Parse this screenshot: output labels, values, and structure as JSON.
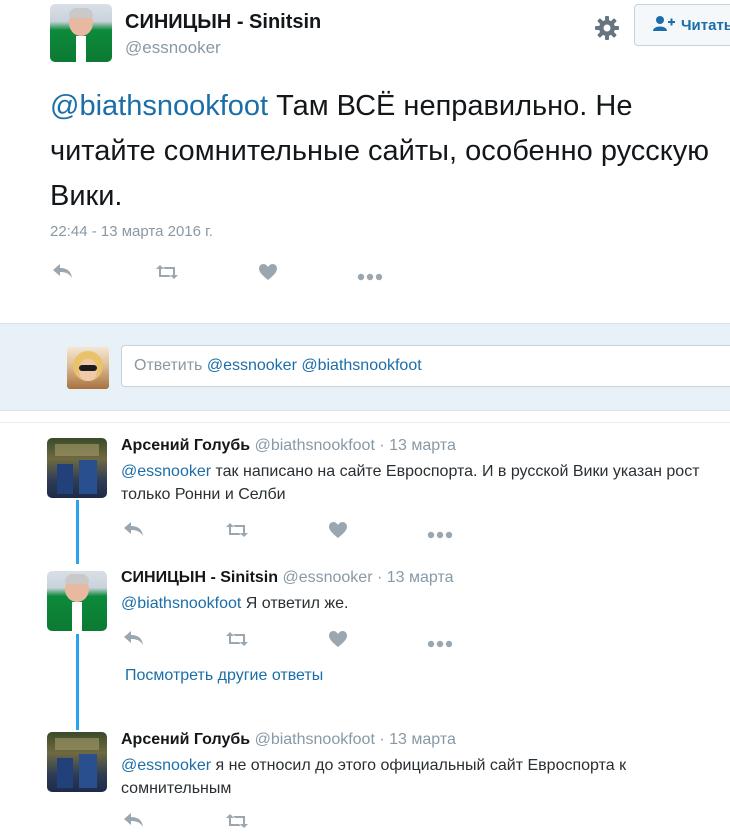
{
  "main_tweet": {
    "author_name": "СИНИЦЫН - Sinitsin",
    "author_handle": "@essnooker",
    "follow_label": "Читать",
    "mention": "@biathsnookfoot",
    "text": " Там ВСЁ неправильно. Не читайте сомнительные сайты, особенно русскую Вики.",
    "timestamp": "22:44 - 13 марта 2016 г.",
    "icons": [
      "reply-icon",
      "retweet-icon",
      "like-icon",
      "more-icon",
      "gear-icon",
      "follow-user-icon"
    ]
  },
  "reply_box": {
    "label": "Ответить ",
    "mentions": "@essnooker @biathsnookfoot"
  },
  "replies": [
    {
      "name": "Арсений Голубь",
      "handle": "@biathsnookfoot",
      "date": "13 марта",
      "mention": "@essnooker",
      "text": " так написано на сайте Евроспорта. И в русской Вики указан рост только Ронни и Селби"
    },
    {
      "name": "СИНИЦЫН - Sinitsin",
      "handle": "@essnooker",
      "date": "13 марта",
      "mention": "@biathsnookfoot",
      "text": " Я ответил же."
    },
    {
      "name": "Арсений Голубь",
      "handle": "@biathsnookfoot",
      "date": "13 марта",
      "mention": "@essnooker",
      "text": " я не относил до этого официальный сайт Евроспорта к сомнительным"
    }
  ],
  "more_replies_link": "Посмотреть другие ответы",
  "separator": " · ",
  "colors": {
    "link": "#1b6ea8",
    "muted": "#8899a6",
    "thread_line": "#2aa3ef",
    "reply_band": "#e9f1f8"
  }
}
